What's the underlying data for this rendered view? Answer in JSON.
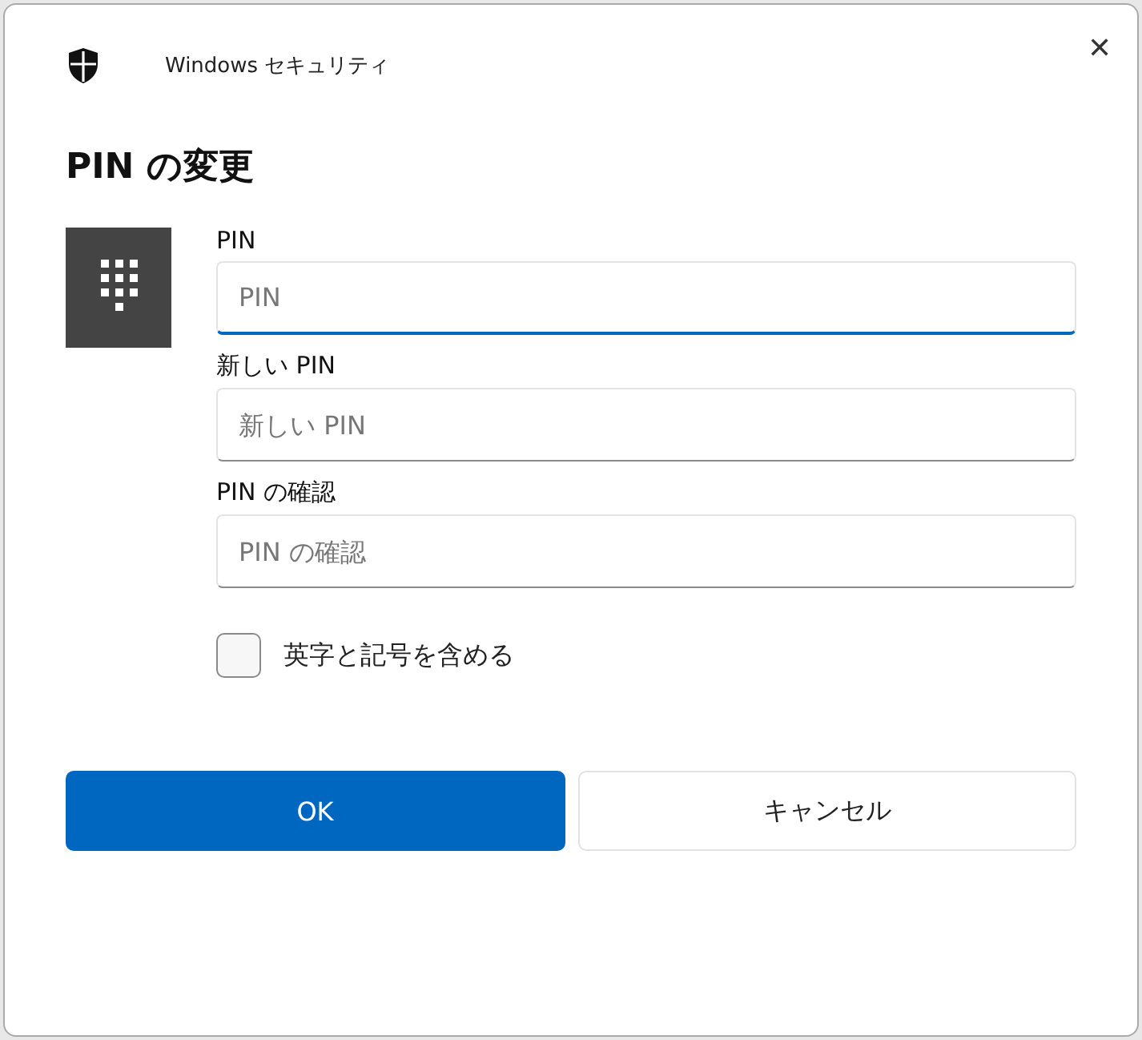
{
  "window": {
    "title": "Windows セキュリティ",
    "close": "✕"
  },
  "heading": "PIN の変更",
  "fields": [
    {
      "label": "PIN",
      "placeholder": "PIN",
      "focused": true
    },
    {
      "label": "新しい PIN",
      "placeholder": "新しい PIN",
      "focused": false
    },
    {
      "label": "PIN の確認",
      "placeholder": "PIN の確認",
      "focused": false
    }
  ],
  "checkbox": {
    "label": "英字と記号を含める",
    "checked": false
  },
  "buttons": [
    {
      "label": "OK",
      "kind": "primary"
    },
    {
      "label": "キャンセル",
      "kind": "secondary"
    }
  ]
}
